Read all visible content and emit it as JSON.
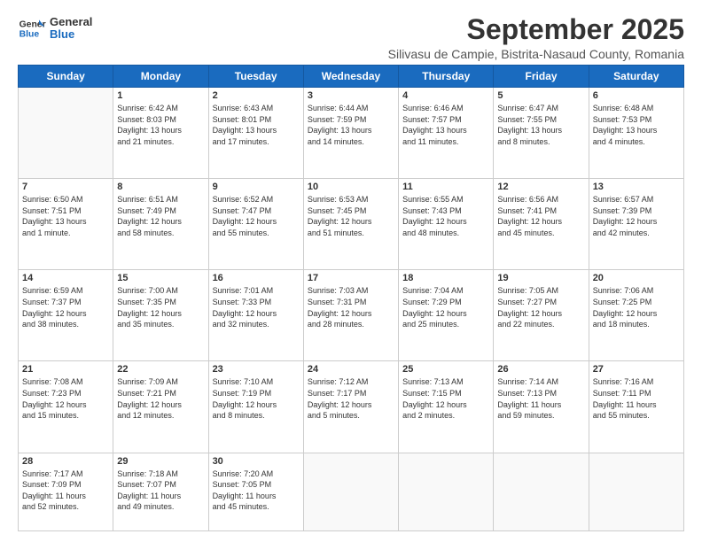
{
  "logo": {
    "line1": "General",
    "line2": "Blue"
  },
  "title": "September 2025",
  "subtitle": "Silivasu de Campie, Bistrita-Nasaud County, Romania",
  "days_of_week": [
    "Sunday",
    "Monday",
    "Tuesday",
    "Wednesday",
    "Thursday",
    "Friday",
    "Saturday"
  ],
  "weeks": [
    [
      {
        "day": "",
        "info": ""
      },
      {
        "day": "1",
        "info": "Sunrise: 6:42 AM\nSunset: 8:03 PM\nDaylight: 13 hours\nand 21 minutes."
      },
      {
        "day": "2",
        "info": "Sunrise: 6:43 AM\nSunset: 8:01 PM\nDaylight: 13 hours\nand 17 minutes."
      },
      {
        "day": "3",
        "info": "Sunrise: 6:44 AM\nSunset: 7:59 PM\nDaylight: 13 hours\nand 14 minutes."
      },
      {
        "day": "4",
        "info": "Sunrise: 6:46 AM\nSunset: 7:57 PM\nDaylight: 13 hours\nand 11 minutes."
      },
      {
        "day": "5",
        "info": "Sunrise: 6:47 AM\nSunset: 7:55 PM\nDaylight: 13 hours\nand 8 minutes."
      },
      {
        "day": "6",
        "info": "Sunrise: 6:48 AM\nSunset: 7:53 PM\nDaylight: 13 hours\nand 4 minutes."
      }
    ],
    [
      {
        "day": "7",
        "info": "Sunrise: 6:50 AM\nSunset: 7:51 PM\nDaylight: 13 hours\nand 1 minute."
      },
      {
        "day": "8",
        "info": "Sunrise: 6:51 AM\nSunset: 7:49 PM\nDaylight: 12 hours\nand 58 minutes."
      },
      {
        "day": "9",
        "info": "Sunrise: 6:52 AM\nSunset: 7:47 PM\nDaylight: 12 hours\nand 55 minutes."
      },
      {
        "day": "10",
        "info": "Sunrise: 6:53 AM\nSunset: 7:45 PM\nDaylight: 12 hours\nand 51 minutes."
      },
      {
        "day": "11",
        "info": "Sunrise: 6:55 AM\nSunset: 7:43 PM\nDaylight: 12 hours\nand 48 minutes."
      },
      {
        "day": "12",
        "info": "Sunrise: 6:56 AM\nSunset: 7:41 PM\nDaylight: 12 hours\nand 45 minutes."
      },
      {
        "day": "13",
        "info": "Sunrise: 6:57 AM\nSunset: 7:39 PM\nDaylight: 12 hours\nand 42 minutes."
      }
    ],
    [
      {
        "day": "14",
        "info": "Sunrise: 6:59 AM\nSunset: 7:37 PM\nDaylight: 12 hours\nand 38 minutes."
      },
      {
        "day": "15",
        "info": "Sunrise: 7:00 AM\nSunset: 7:35 PM\nDaylight: 12 hours\nand 35 minutes."
      },
      {
        "day": "16",
        "info": "Sunrise: 7:01 AM\nSunset: 7:33 PM\nDaylight: 12 hours\nand 32 minutes."
      },
      {
        "day": "17",
        "info": "Sunrise: 7:03 AM\nSunset: 7:31 PM\nDaylight: 12 hours\nand 28 minutes."
      },
      {
        "day": "18",
        "info": "Sunrise: 7:04 AM\nSunset: 7:29 PM\nDaylight: 12 hours\nand 25 minutes."
      },
      {
        "day": "19",
        "info": "Sunrise: 7:05 AM\nSunset: 7:27 PM\nDaylight: 12 hours\nand 22 minutes."
      },
      {
        "day": "20",
        "info": "Sunrise: 7:06 AM\nSunset: 7:25 PM\nDaylight: 12 hours\nand 18 minutes."
      }
    ],
    [
      {
        "day": "21",
        "info": "Sunrise: 7:08 AM\nSunset: 7:23 PM\nDaylight: 12 hours\nand 15 minutes."
      },
      {
        "day": "22",
        "info": "Sunrise: 7:09 AM\nSunset: 7:21 PM\nDaylight: 12 hours\nand 12 minutes."
      },
      {
        "day": "23",
        "info": "Sunrise: 7:10 AM\nSunset: 7:19 PM\nDaylight: 12 hours\nand 8 minutes."
      },
      {
        "day": "24",
        "info": "Sunrise: 7:12 AM\nSunset: 7:17 PM\nDaylight: 12 hours\nand 5 minutes."
      },
      {
        "day": "25",
        "info": "Sunrise: 7:13 AM\nSunset: 7:15 PM\nDaylight: 12 hours\nand 2 minutes."
      },
      {
        "day": "26",
        "info": "Sunrise: 7:14 AM\nSunset: 7:13 PM\nDaylight: 11 hours\nand 59 minutes."
      },
      {
        "day": "27",
        "info": "Sunrise: 7:16 AM\nSunset: 7:11 PM\nDaylight: 11 hours\nand 55 minutes."
      }
    ],
    [
      {
        "day": "28",
        "info": "Sunrise: 7:17 AM\nSunset: 7:09 PM\nDaylight: 11 hours\nand 52 minutes."
      },
      {
        "day": "29",
        "info": "Sunrise: 7:18 AM\nSunset: 7:07 PM\nDaylight: 11 hours\nand 49 minutes."
      },
      {
        "day": "30",
        "info": "Sunrise: 7:20 AM\nSunset: 7:05 PM\nDaylight: 11 hours\nand 45 minutes."
      },
      {
        "day": "",
        "info": ""
      },
      {
        "day": "",
        "info": ""
      },
      {
        "day": "",
        "info": ""
      },
      {
        "day": "",
        "info": ""
      }
    ]
  ]
}
